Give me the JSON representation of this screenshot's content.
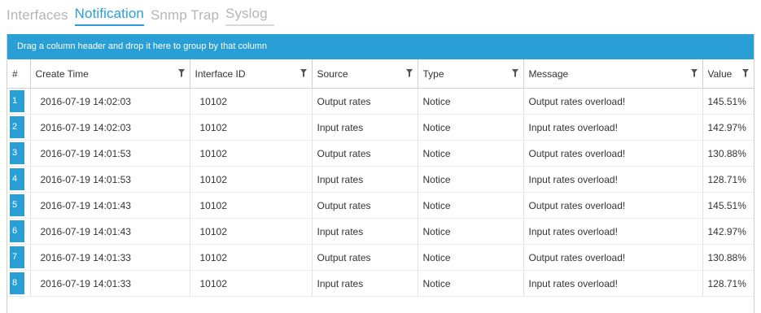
{
  "tabs": [
    {
      "label": "Interfaces",
      "active": false
    },
    {
      "label": "Notification",
      "active": true
    },
    {
      "label": "Snmp Trap",
      "active": false
    },
    {
      "label": "Syslog",
      "active": false
    }
  ],
  "group_bar": "Drag a column header and drop it here to group by that column",
  "columns": [
    "#",
    "Create Time",
    "Interface ID",
    "Source",
    "Type",
    "Message",
    "Value"
  ],
  "rows": [
    {
      "n": "1",
      "time": "2016-07-19 14:02:03",
      "iface": "10102",
      "source": "Output rates",
      "type": "Notice",
      "message": "Output rates overload!",
      "value": "145.51%"
    },
    {
      "n": "2",
      "time": "2016-07-19 14:02:03",
      "iface": "10102",
      "source": "Input rates",
      "type": "Notice",
      "message": "Input rates overload!",
      "value": "142.97%"
    },
    {
      "n": "3",
      "time": "2016-07-19 14:01:53",
      "iface": "10102",
      "source": "Output rates",
      "type": "Notice",
      "message": "Output rates overload!",
      "value": "130.88%"
    },
    {
      "n": "4",
      "time": "2016-07-19 14:01:53",
      "iface": "10102",
      "source": "Input rates",
      "type": "Notice",
      "message": "Input rates overload!",
      "value": "128.71%"
    },
    {
      "n": "5",
      "time": "2016-07-19 14:01:43",
      "iface": "10102",
      "source": "Output rates",
      "type": "Notice",
      "message": "Output rates overload!",
      "value": "145.51%"
    },
    {
      "n": "6",
      "time": "2016-07-19 14:01:43",
      "iface": "10102",
      "source": "Input rates",
      "type": "Notice",
      "message": "Input rates overload!",
      "value": "142.97%"
    },
    {
      "n": "7",
      "time": "2016-07-19 14:01:33",
      "iface": "10102",
      "source": "Output rates",
      "type": "Notice",
      "message": "Output rates overload!",
      "value": "130.88%"
    },
    {
      "n": "8",
      "time": "2016-07-19 14:01:33",
      "iface": "10102",
      "source": "Input rates",
      "type": "Notice",
      "message": "Input rates overload!",
      "value": "128.71%"
    }
  ],
  "colors": {
    "accent": "#2a9fd6",
    "tab_inactive": "#b5b5b5"
  },
  "icons": {
    "filter": "filter-icon"
  }
}
